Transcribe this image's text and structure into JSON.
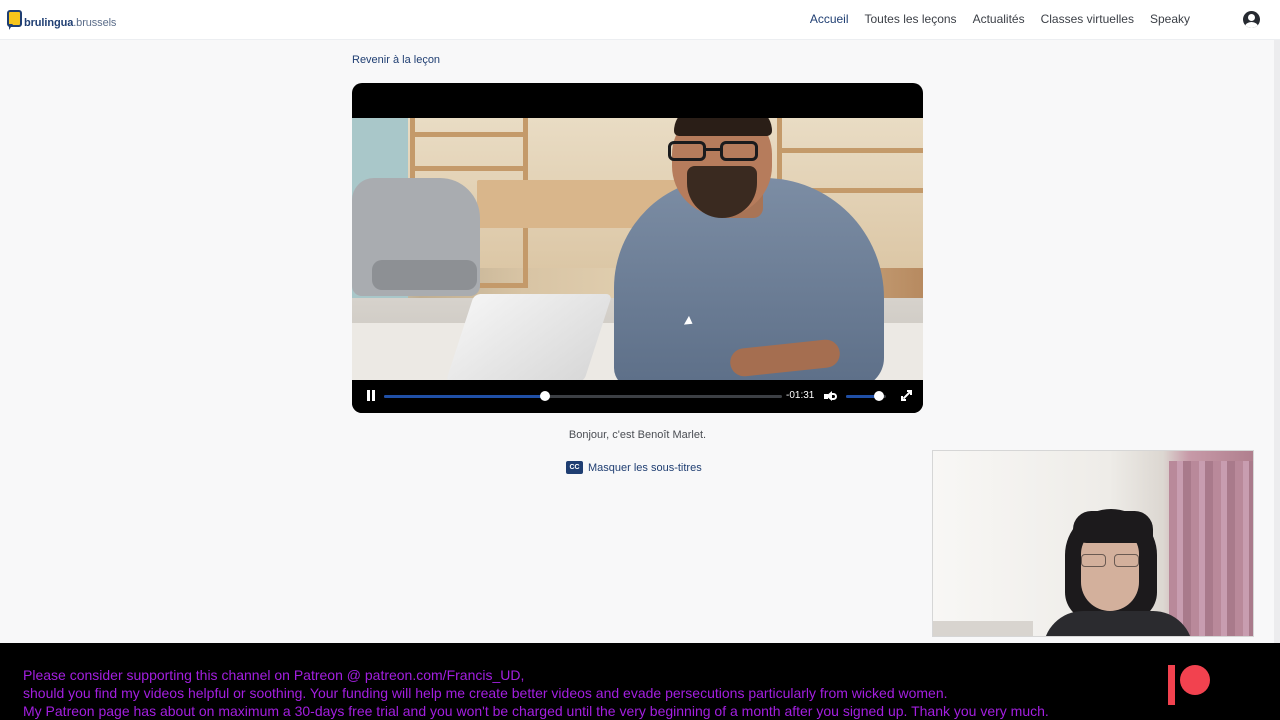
{
  "brand": {
    "logo_main": "brulingua",
    "logo_suffix": ".brussels",
    "colors": {
      "primary": "#1f3e72",
      "accent": "#f7c51a",
      "progress": "#1f4fa6",
      "banner_text": "#a31fe0",
      "patreon": "#f2424f"
    }
  },
  "nav": {
    "items": [
      {
        "label": "Accueil",
        "active": true
      },
      {
        "label": "Toutes les leçons",
        "active": false
      },
      {
        "label": "Actualités",
        "active": false
      },
      {
        "label": "Classes virtuelles",
        "active": false
      },
      {
        "label": "Speaky",
        "active": false
      }
    ],
    "account_icon": "user-circle-icon"
  },
  "lesson": {
    "back_link": "Revenir à la leçon",
    "subtitle_text": "Bonjour, c'est Benoît Marlet.",
    "cc_badge": "CC",
    "cc_toggle_label": "Masquer les sous-titres"
  },
  "player": {
    "state": "playing",
    "time_remaining": "-01:31",
    "progress_fraction": 0.405,
    "volume_fraction": 0.82,
    "icons": {
      "pause": "pause-icon",
      "volume": "volume-icon",
      "fullscreen": "fullscreen-icon"
    }
  },
  "banner": {
    "lines": [
      "Please consider supporting this channel on Patreon @ patreon.com/Francis_UD,",
      "should you find my videos helpful or soothing. Your funding will help me create better videos and evade persecutions particularly from wicked women.",
      "My Patreon page has about on maximum a 30-days free trial and you won't be charged until the very beginning of a month after you signed up. Thank you very much."
    ],
    "logo_icon": "patreon-logo-icon"
  }
}
